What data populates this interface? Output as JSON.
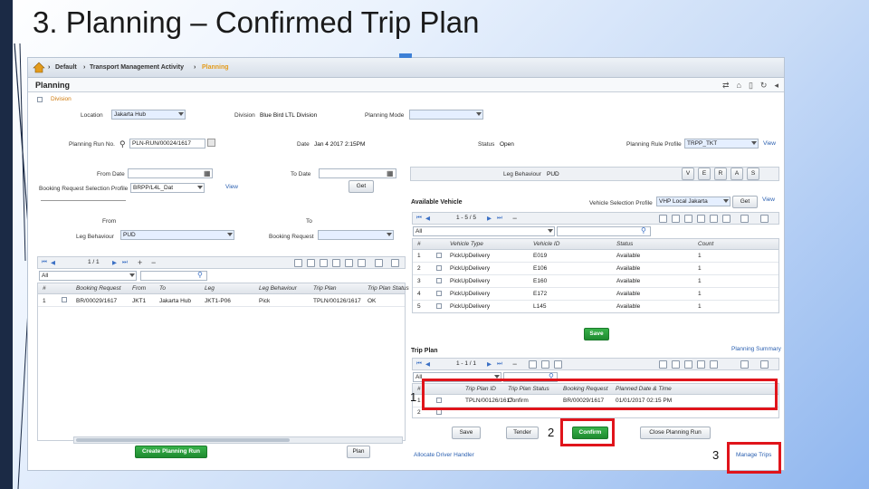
{
  "slide": {
    "title": "3. Planning – Confirmed Trip Plan"
  },
  "breadcrumb": {
    "items": [
      "Default",
      "Transport Management Activity",
      "Planning"
    ],
    "sep": "›"
  },
  "page": {
    "title": "Planning",
    "section": "Division",
    "icons": [
      "⇄",
      "⌂",
      "▯",
      "↻",
      "◂"
    ]
  },
  "form": {
    "location_label": "Location",
    "location_value": "Jakarta Hub",
    "division_label": "Division",
    "division_value": "Blue Bird LTL Division",
    "planning_mode_label": "Planning Mode",
    "planning_mode_value": "",
    "run_no_label": "Planning Run No.",
    "run_no_value": "PLN-RUN/00024/1617",
    "date_label": "Date",
    "date_value": "Jan 4 2017 2:15PM",
    "status_label": "Status",
    "status_value": "Open",
    "rule_profile_label": "Planning Rule Profile",
    "rule_profile_value": "TRPP_TKT",
    "rule_profile_view": "View",
    "from_date_label": "From Date",
    "to_date_label": "To Date",
    "booking_profile_label": "Booking Request Selection Profile",
    "booking_profile_value": "BRPP/L4L_Dat",
    "booking_profile_view": "View",
    "get_button": "Get",
    "from_label": "From",
    "to_label": "To",
    "leg_behaviour_label": "Leg Behaviour",
    "leg_behaviour_value": "PUD",
    "booking_req_label": "Booking Request",
    "booking_req_value": ""
  },
  "left_grid": {
    "pager": "1 / 1",
    "filter": "All",
    "headers": [
      "#",
      "Booking Request",
      "From",
      "To",
      "Leg",
      "Leg Behaviour",
      "Trip Plan",
      "Trip Plan Status"
    ],
    "rows": [
      [
        "1",
        "BR/00029/1617",
        "JKT1",
        "Jakarta Hub",
        "JKT1-P06",
        "Pick",
        "TPLN/00126/1617",
        "OK"
      ]
    ],
    "create_button": "Create Planning Run",
    "plan_button": "Plan"
  },
  "vehicle": {
    "leg_behaviour_label": "Leg Behaviour",
    "leg_behaviour_value": "PUD",
    "letters": [
      "V",
      "E",
      "R",
      "A",
      "S"
    ],
    "title": "Available Vehicle",
    "profile_label": "Vehicle Selection Profile",
    "profile_value": "VHP Local Jakarta",
    "get_button": "Get",
    "view_link": "View",
    "pager": "1 - 5 / 5",
    "filter": "All",
    "headers": [
      "#",
      "Vehicle Type",
      "Vehicle ID",
      "Status",
      "Count"
    ],
    "rows": [
      [
        "1",
        "PickUpDelivery",
        "E019",
        "Available",
        "1"
      ],
      [
        "2",
        "PickUpDelivery",
        "E106",
        "Available",
        "1"
      ],
      [
        "3",
        "PickUpDelivery",
        "E160",
        "Available",
        "1"
      ],
      [
        "4",
        "PickUpDelivery",
        "E172",
        "Available",
        "1"
      ],
      [
        "5",
        "PickUpDelivery",
        "L145",
        "Available",
        "1"
      ]
    ],
    "save_button": "Save"
  },
  "trip_plan": {
    "title": "Trip Plan",
    "summary_link": "Planning Summary",
    "pager": "1 - 1 / 1",
    "filter": "All",
    "headers": [
      "#",
      "Trip Plan ID",
      "Trip Plan Status",
      "Booking Request",
      "Planned Date & Time"
    ],
    "rows": [
      [
        "1",
        "TPLN/00126/1617",
        "Confirm",
        "BR/00029/1617",
        "01/01/2017 02:15 PM"
      ],
      [
        "2",
        "",
        "",
        "",
        ""
      ]
    ],
    "save_button": "Save",
    "tender_button": "Tender",
    "confirm_button": "Confirm",
    "close_button": "Close Planning Run",
    "allocate_link": "Allocate Driver Handler",
    "manage_link": "Manage Trips"
  },
  "markers": [
    "1",
    "2",
    "3"
  ],
  "colors": {
    "navy": "#1b2a45",
    "highlight": "#e0141b",
    "green": "#2a9c3c",
    "link": "#2a5fb0"
  }
}
